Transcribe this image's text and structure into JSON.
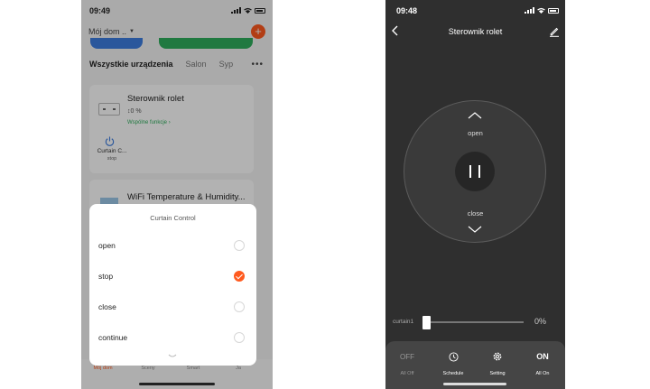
{
  "left": {
    "status": {
      "time": "09:49"
    },
    "header": {
      "home_label": "Mój dom .."
    },
    "tabs": [
      "Wszystkie urządzenia",
      "Salon",
      "Syp"
    ],
    "device1": {
      "name": "Sterownik rolet",
      "percent": "↕0 %",
      "functions": "Wspólne funkcje ›",
      "quick_name": "Curtain C...",
      "quick_state": "stop"
    },
    "device2": {
      "name": "WiFi Temperature & Humidity..."
    },
    "nav": [
      "Mój dom",
      "Sceny",
      "Smart",
      "Ja"
    ],
    "sheet": {
      "title": "Curtain Control",
      "options": [
        {
          "label": "open",
          "checked": false
        },
        {
          "label": "stop",
          "checked": true
        },
        {
          "label": "close",
          "checked": false
        },
        {
          "label": "continue",
          "checked": false
        }
      ]
    }
  },
  "right": {
    "status": {
      "time": "09:48"
    },
    "title": "Sterownik rolet",
    "open_label": "open",
    "close_label": "close",
    "slider": {
      "label": "curtain1",
      "value_text": "0%",
      "percent": 0
    },
    "buttons": [
      {
        "icon_text": "OFF",
        "label": "All Off"
      },
      {
        "icon_text": "",
        "label": "Schedule"
      },
      {
        "icon_text": "",
        "label": "Setting"
      },
      {
        "icon_text": "ON",
        "label": "All On"
      }
    ]
  },
  "colors": {
    "accent": "#ff5a1f",
    "green": "#2fae5c",
    "blue": "#3d7de0",
    "dark_bg": "#2f2f2f"
  }
}
